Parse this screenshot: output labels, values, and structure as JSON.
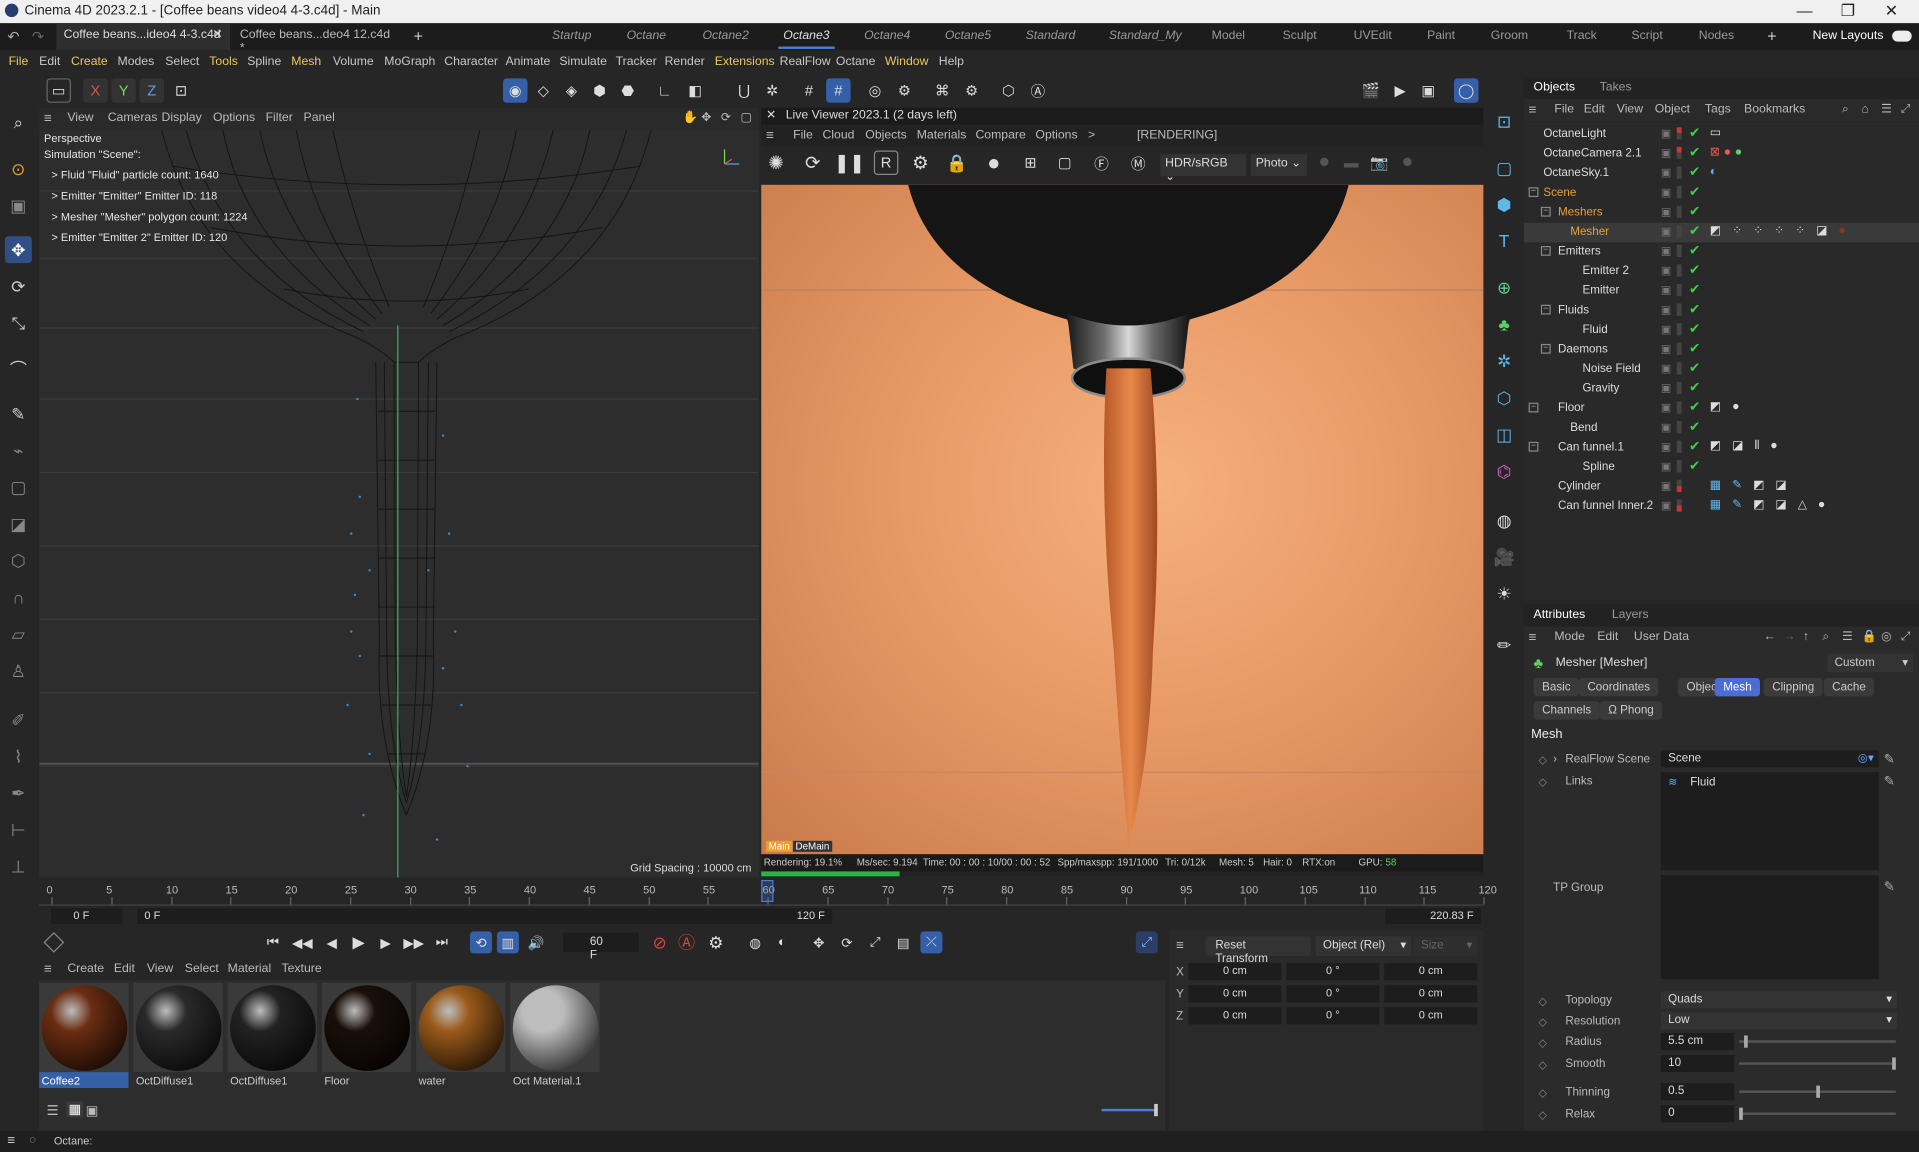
{
  "window": {
    "title": "Cinema 4D 2023.2.1 - [Coffee beans video4 4-3.c4d] - Main"
  },
  "doc_tabs": [
    {
      "label": "Coffee beans...ideo4 4-3.c4d"
    },
    {
      "label": "Coffee beans...deo4 12.c4d *"
    }
  ],
  "layouts": [
    "Startup",
    "Octane",
    "Octane2",
    "Octane3",
    "Octane4",
    "Octane5",
    "Standard",
    "Standard_My",
    "Model",
    "Sculpt",
    "UVEdit",
    "Paint",
    "Groom",
    "Track",
    "Script",
    "Nodes"
  ],
  "new_layouts": "New Layouts",
  "menu": [
    "File",
    "Edit",
    "Create",
    "Modes",
    "Select",
    "Tools",
    "Spline",
    "Mesh",
    "Volume",
    "MoGraph",
    "Character",
    "Animate",
    "Simulate",
    "Tracker",
    "Render",
    "Extensions",
    "RealFlow",
    "Octane",
    "Window",
    "Help"
  ],
  "axes": {
    "x": "X",
    "y": "Y",
    "z": "Z"
  },
  "viewport": {
    "menu": [
      "View",
      "Cameras",
      "Display",
      "Options",
      "Filter",
      "Panel"
    ],
    "name": "Perspective",
    "hud": [
      "Simulation \"Scene\":",
      "> Fluid \"Fluid\" particle count: 1640",
      "> Emitter \"Emitter\" Emitter ID: 118",
      "> Mesher \"Mesher\" polygon count: 1224",
      "> Emitter \"Emitter 2\" Emitter ID: 120"
    ],
    "grid_spacing": "Grid Spacing : 10000 cm"
  },
  "live_viewer": {
    "title": "Live Viewer 2023.1 (2 days left)",
    "menu": [
      "File",
      "Cloud",
      "Objects",
      "Materials",
      "Compare",
      "Options",
      ">"
    ],
    "state": "[RENDERING]",
    "colorspace": "HDR/sRGB",
    "mode": "Photo",
    "pass_tags": [
      "Main",
      "DeMain"
    ],
    "status": {
      "rendering": "Rendering: 19.1%",
      "mssec": "Ms/sec: 9.194",
      "time": "Time: 00 : 00 : 10/00 : 00 : 52",
      "spp": "Spp/maxspp: 191/1000",
      "tri": "Tri: 0/12k",
      "mesh": "Mesh: 5",
      "hair": "Hair: 0",
      "rtx": "RTX:on",
      "gpu_label": "GPU:",
      "gpu_value": "58"
    },
    "progress": 0.191
  },
  "objects_panel": {
    "tabs": [
      "Objects",
      "Takes"
    ],
    "menu": [
      "File",
      "Edit",
      "View",
      "Object",
      "Tags",
      "Bookmarks"
    ],
    "items": [
      {
        "name": "OctaneLight",
        "depth": 0
      },
      {
        "name": "OctaneCamera 2.1",
        "depth": 0
      },
      {
        "name": "OctaneSky.1",
        "depth": 0
      },
      {
        "name": "Scene",
        "depth": 0
      },
      {
        "name": "Meshers",
        "depth": 1
      },
      {
        "name": "Mesher",
        "depth": 2
      },
      {
        "name": "Emitters",
        "depth": 1
      },
      {
        "name": "Emitter 2",
        "depth": 2
      },
      {
        "name": "Emitter",
        "depth": 2
      },
      {
        "name": "Fluids",
        "depth": 1
      },
      {
        "name": "Fluid",
        "depth": 2
      },
      {
        "name": "Daemons",
        "depth": 1
      },
      {
        "name": "Noise Field",
        "depth": 2
      },
      {
        "name": "Gravity",
        "depth": 2
      },
      {
        "name": "Floor",
        "depth": 0
      },
      {
        "name": "Bend",
        "depth": 1
      },
      {
        "name": "Can funnel.1",
        "depth": 0
      },
      {
        "name": "Spline",
        "depth": 1
      },
      {
        "name": "Cylinder",
        "depth": 0
      },
      {
        "name": "Can funnel Inner.2",
        "depth": 0
      }
    ]
  },
  "attributes_panel": {
    "tabs": [
      "Attributes",
      "Layers"
    ],
    "menu": [
      "Mode",
      "Edit",
      "User Data"
    ],
    "object": "Mesher [Mesher]",
    "preset": "Custom",
    "subtabs": [
      "Basic",
      "Coordinates",
      "Object",
      "Mesh",
      "Clipping",
      "Cache",
      "Channels",
      "Phong"
    ],
    "active_subtab": "Mesh",
    "section": "Mesh",
    "realflow_scene_label": "RealFlow Scene",
    "realflow_scene_value": "Scene",
    "links_label": "Links",
    "links_value": "Fluid",
    "tp_group_label": "TP Group",
    "topology": {
      "label": "Topology",
      "value": "Quads"
    },
    "resolution": {
      "label": "Resolution",
      "value": "Low"
    },
    "radius": {
      "label": "Radius",
      "value": "5.5 cm",
      "level": 0.03
    },
    "smooth": {
      "label": "Smooth",
      "value": "10",
      "level": 1.0
    },
    "thinning": {
      "label": "Thinning",
      "value": "0.5",
      "level": 0.5
    },
    "relax": {
      "label": "Relax",
      "value": "0",
      "level": 0.0
    }
  },
  "timeline": {
    "ticks": [
      "0",
      "5",
      "10",
      "15",
      "20",
      "25",
      "30",
      "35",
      "40",
      "45",
      "50",
      "55",
      "60",
      "65",
      "70",
      "75",
      "80",
      "85",
      "90",
      "95",
      "100",
      "105",
      "110",
      "115",
      "120"
    ],
    "current_frame": 60,
    "start": "0 F",
    "start2": "0 F",
    "end": "120 F",
    "end_value": "220.83 F",
    "frame_field": "60 F"
  },
  "coordinates": {
    "reset": "Reset Transform",
    "mode": "Object (Rel)",
    "size": "Size",
    "rows": [
      {
        "axis": "X",
        "pos": "0 cm",
        "rot": "0 °",
        "scale": "0 cm"
      },
      {
        "axis": "Y",
        "pos": "0 cm",
        "rot": "0 °",
        "scale": "0 cm"
      },
      {
        "axis": "Z",
        "pos": "0 cm",
        "rot": "0 °",
        "scale": "0 cm"
      }
    ]
  },
  "materials": {
    "menu": [
      "Create",
      "Edit",
      "View",
      "Select",
      "Material",
      "Texture"
    ],
    "items": [
      {
        "name": "Coffee2",
        "color": "#6a2d12"
      },
      {
        "name": "OctDiffuse1",
        "color": "#2a2a2a"
      },
      {
        "name": "OctDiffuse1",
        "color": "#222222"
      },
      {
        "name": "Floor",
        "color": "#1a0f0a"
      },
      {
        "name": "water",
        "color": "#9a5a1a"
      },
      {
        "name": "Oct Material.1",
        "color": "#bdbdbd"
      }
    ]
  },
  "statusbar": {
    "text": "Octane:"
  }
}
